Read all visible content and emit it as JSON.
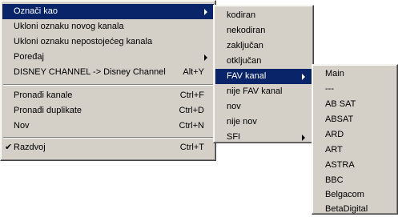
{
  "main_menu": {
    "items": [
      {
        "label": "Označi kao"
      },
      {
        "label": "Ukloni oznaku novog kanala"
      },
      {
        "label": "Ukloni oznaku nepostojećeg kanala"
      },
      {
        "label": "Poređaj"
      },
      {
        "label": "DISNEY CHANNEL -> Disney Channel",
        "shortcut": "Alt+Y"
      },
      {
        "label": "Pronađi kanale",
        "shortcut": "Ctrl+F"
      },
      {
        "label": "Pronađi duplikate",
        "shortcut": "Ctrl+D"
      },
      {
        "label": "Nov",
        "shortcut": "Ctrl+N"
      },
      {
        "label": "Razdvoj",
        "shortcut": "Ctrl+T",
        "check": "✔"
      }
    ]
  },
  "oznaci_submenu": {
    "items": [
      {
        "label": "kodiran"
      },
      {
        "label": "nekodiran"
      },
      {
        "label": "zaključan"
      },
      {
        "label": "otključan"
      },
      {
        "label": "FAV kanal"
      },
      {
        "label": "nije FAV kanal"
      },
      {
        "label": "nov"
      },
      {
        "label": "nije nov"
      },
      {
        "label": "SFI"
      }
    ]
  },
  "fav_submenu": {
    "items": [
      {
        "label": "Main"
      },
      {
        "label": "---"
      },
      {
        "label": "AB SAT"
      },
      {
        "label": "ABSAT"
      },
      {
        "label": "ARD"
      },
      {
        "label": "ART"
      },
      {
        "label": "ASTRA"
      },
      {
        "label": "BBC"
      },
      {
        "label": "Belgacom"
      },
      {
        "label": "BetaDigital"
      }
    ]
  },
  "colors": {
    "menu_face": "#d4d0c8",
    "highlight": "#0a246a",
    "highlight_text": "#ffffff"
  }
}
